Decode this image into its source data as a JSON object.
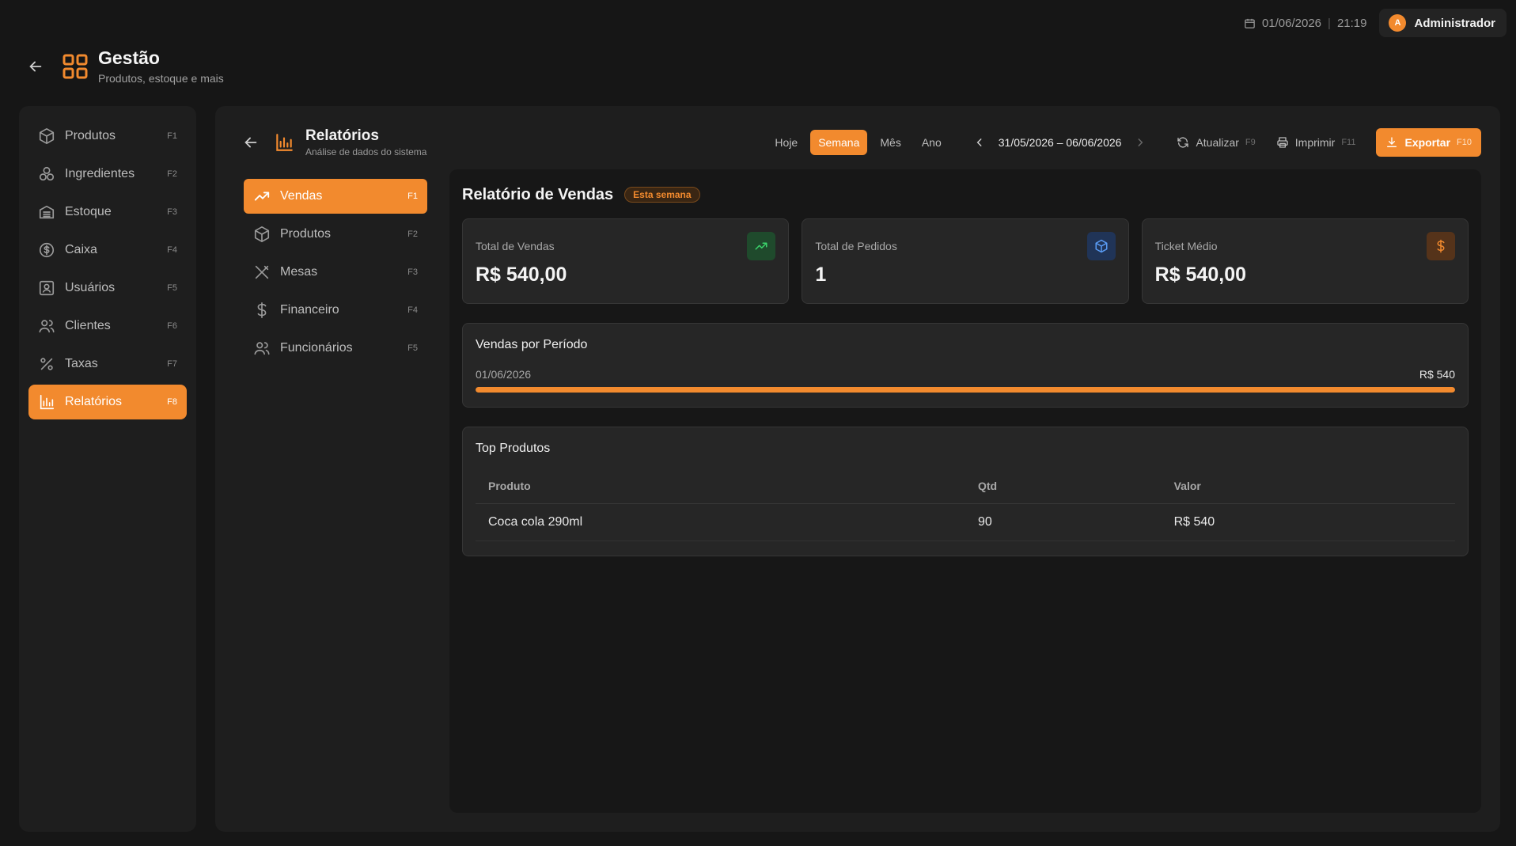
{
  "topbar": {
    "date": "01/06/2026",
    "separator": "|",
    "time": "21:19",
    "user_initial": "A",
    "user_name": "Administrador"
  },
  "app": {
    "title": "Gestão",
    "subtitle": "Produtos, estoque e mais",
    "accent": "#f28a2e"
  },
  "sidebar": {
    "items": [
      {
        "label": "Produtos",
        "key": "F1",
        "icon": "box-icon"
      },
      {
        "label": "Ingredientes",
        "key": "F2",
        "icon": "ingredients-icon"
      },
      {
        "label": "Estoque",
        "key": "F3",
        "icon": "warehouse-icon"
      },
      {
        "label": "Caixa",
        "key": "F4",
        "icon": "dollar-circle-icon"
      },
      {
        "label": "Usuários",
        "key": "F5",
        "icon": "user-badge-icon"
      },
      {
        "label": "Clientes",
        "key": "F6",
        "icon": "users-icon"
      },
      {
        "label": "Taxas",
        "key": "F7",
        "icon": "percent-icon"
      },
      {
        "label": "Relatórios",
        "key": "F8",
        "icon": "bar-chart-icon",
        "active": true
      }
    ]
  },
  "main": {
    "title": "Relatórios",
    "subtitle": "Análise de dados do sistema",
    "periods": [
      "Hoje",
      "Semana",
      "Mês",
      "Ano"
    ],
    "active_period": "Semana",
    "range": "31/05/2026 – 06/06/2026",
    "refresh_label": "Atualizar",
    "refresh_key": "F9",
    "print_label": "Imprimir",
    "print_key": "F11",
    "export_label": "Exportar",
    "export_key": "F10"
  },
  "submenu": {
    "items": [
      {
        "label": "Vendas",
        "key": "F1",
        "icon": "trending-up-icon",
        "active": true
      },
      {
        "label": "Produtos",
        "key": "F2",
        "icon": "box-icon"
      },
      {
        "label": "Mesas",
        "key": "F3",
        "icon": "utensils-icon"
      },
      {
        "label": "Financeiro",
        "key": "F4",
        "icon": "dollar-icon"
      },
      {
        "label": "Funcionários",
        "key": "F5",
        "icon": "users-icon"
      }
    ]
  },
  "report": {
    "title": "Relatório de Vendas",
    "badge": "Esta semana",
    "cards": [
      {
        "label": "Total de Vendas",
        "value": "R$ 540,00",
        "icon": "trending-up-icon",
        "color": "#3bd46b"
      },
      {
        "label": "Total de Pedidos",
        "value": "1",
        "icon": "box-icon",
        "color": "#5a9cf5"
      },
      {
        "label": "Ticket Médio",
        "value": "R$ 540,00",
        "icon": "dollar-icon",
        "color": "#f28a2e"
      }
    ],
    "period_panel": {
      "title": "Vendas por Período",
      "rows": [
        {
          "date": "01/06/2026",
          "value": "R$ 540",
          "fraction": 1.0
        }
      ]
    },
    "top_products": {
      "title": "Top Produtos",
      "columns": [
        "Produto",
        "Qtd",
        "Valor"
      ],
      "rows": [
        {
          "product": "Coca cola 290ml",
          "qty": "90",
          "value": "R$ 540"
        }
      ]
    }
  }
}
